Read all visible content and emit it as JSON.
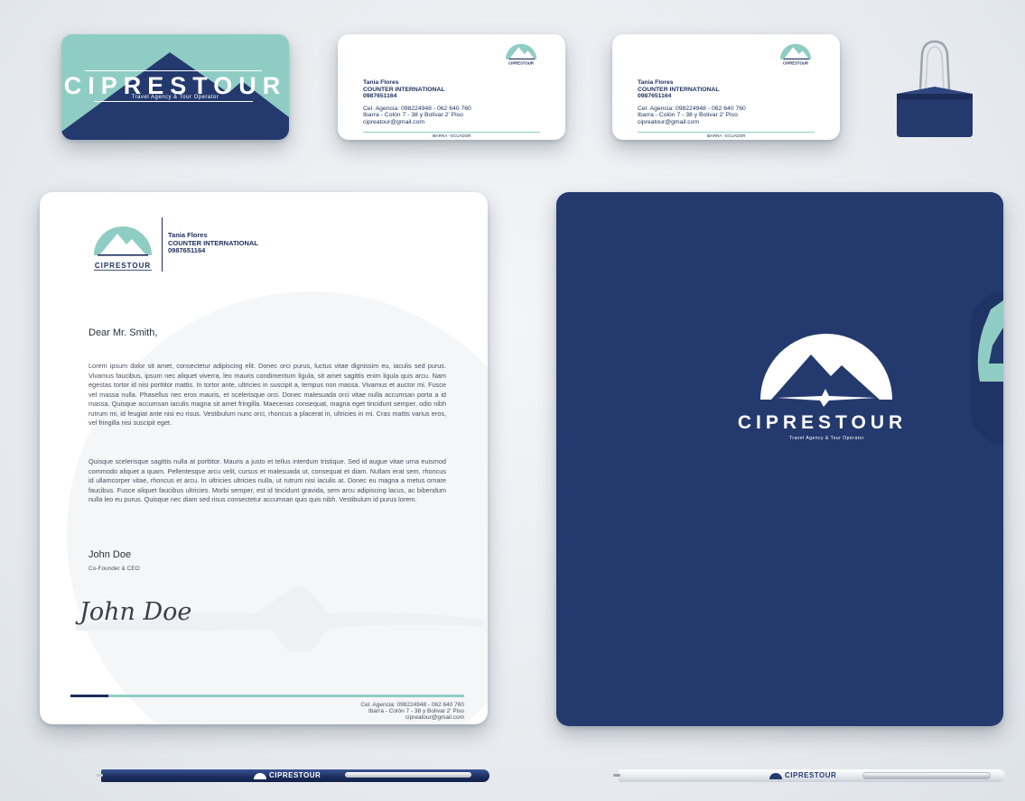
{
  "brand": {
    "name": "CIPRESTOUR",
    "tagline": "Travel Agency & Tour Operator",
    "colors": {
      "navy": "#243a6e",
      "teal": "#8fcdc4",
      "white": "#ffffff"
    }
  },
  "card_back": {
    "name": "Tania Flores",
    "title": "COUNTER INTERNATIONAL",
    "phone": "0987651164",
    "agency_phone": "Cel. Agencia: 098224948 - 062 640 760",
    "address": "Ibarra - Colón 7 - 38 y Bolivar 2' Piso",
    "email": "cipreatour@gmail.com",
    "footer": "IBARRA - ECUADOR"
  },
  "letterhead": {
    "contact_name": "Tania Flores",
    "contact_title": "COUNTER INTERNATIONAL",
    "contact_phone": "0987651164",
    "logo_text": "CIPRESTOUR",
    "greeting": "Dear Mr. Smith,",
    "paragraph_1": "Lorem ipsum dolor sit amet, consectetur adipiscing elit. Donec orci purus, luctus vitae dignissim eu, iaculis sed purus. Vivamus faucibus, ipsum nec aliquet viverra, leo mauris condimentum ligula, sit amet sagittis enim ligula quis arcu. Nam egestas tortor id nisi porttitor mattis. In tortor ante, ultricies in suscipit a, tempus non massa. Vivamus et auctor mi. Fusce vel massa nulla. Phasellus nec eros mauris, et scelerisque orci. Donec malesuada orci vitae nulla accumsan porta a id massa. Quisque accumsan iaculis magna sit amet fringilla. Maecenas consequat, magna eget tincidunt semper, odio nibh rutrum mi, id feugiat ante nisi eu risus. Vestibulum nunc orci, rhoncus a placerat in, ultricies in mi. Cras mattis varius eros, vel fringilla nisi suscipit eget.",
    "paragraph_2": "Quisque scelerisque sagittis nulla at porttitor. Mauris a justo et tellus interdum tristique. Sed id augue vitae urna euismod commodo aliquet a quam. Pellentesque arcu velit, cursus et malesuada ut, consequat et diam. Nullam erat sem, rhoncus id ullamcorper vitae, rhoncus et arcu. In ultricies ultricies nulla, ut rutrum nisi iaculis at. Donec eu magna a metus ornare faucibus. Fusce aliquet faucibus ultricies. Morbi semper, est id tincidunt gravida, sem arcu adipiscing lacus, ac bibendum nulla leo eu purus. Quisque nec diam sed risus consectetur accumsan quis quis nibh. Vestibulum id purus lorem.",
    "signer_name": "John Doe",
    "signer_role": "Co-Founder & CEO",
    "signature": "John Doe",
    "footer_phone": "Cel. Agencia: 098224948 - 062 640 760",
    "footer_address": "Ibarra - Colón 7 - 38 y Bolivar 2' Piso",
    "footer_email": "cipreatour@gmail.com"
  },
  "pens": {
    "brand": "CIPRESTOUR"
  },
  "icons": {
    "logo": "mountain-airplane-icon",
    "clip": "binder-clip-icon"
  }
}
